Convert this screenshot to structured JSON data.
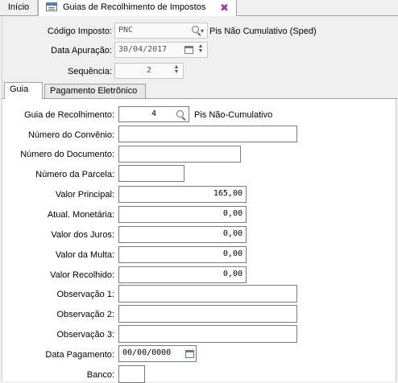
{
  "tabs": {
    "inicio": "Início",
    "guias": "Guias de Recolhimento de Impostos"
  },
  "header": {
    "codigo_imposto": {
      "label": "Código Imposto:",
      "value": "PNC",
      "description": "Pis Não Cumulativo (Sped)"
    },
    "data_apuracao": {
      "label": "Data Apuração:",
      "value": "30/04/2017"
    },
    "sequencia": {
      "label": "Sequência:",
      "value": "2"
    }
  },
  "inner_tabs": {
    "guia": "Guia",
    "pagamento": "Pagamento Eletrônico"
  },
  "form": {
    "guia_recolhimento": {
      "label": "Guia de Recolhimento:",
      "value": "4",
      "description": "Pis Não-Cumulativo"
    },
    "numero_convenio": {
      "label": "Número do Convênio:",
      "value": ""
    },
    "numero_documento": {
      "label": "Número do Documento:",
      "value": ""
    },
    "numero_parcela": {
      "label": "Número da Parcela:",
      "value": ""
    },
    "valor_principal": {
      "label": "Valor Principal:",
      "value": "165,00"
    },
    "atual_monetaria": {
      "label": "Atual. Monetária:",
      "value": "0,00"
    },
    "valor_juros": {
      "label": "Valor dos Juros:",
      "value": "0,00"
    },
    "valor_multa": {
      "label": "Valor da Multa:",
      "value": "0,00"
    },
    "valor_recolhido": {
      "label": "Valor Recolhido:",
      "value": "0,00"
    },
    "observacao1": {
      "label": "Observação 1:",
      "value": ""
    },
    "observacao2": {
      "label": "Observação 2:",
      "value": ""
    },
    "observacao3": {
      "label": "Observação 3:",
      "value": ""
    },
    "data_pagamento": {
      "label": "Data Pagamento:",
      "value": "00/00/0000"
    },
    "banco": {
      "label": "Banco:",
      "value": ""
    }
  }
}
